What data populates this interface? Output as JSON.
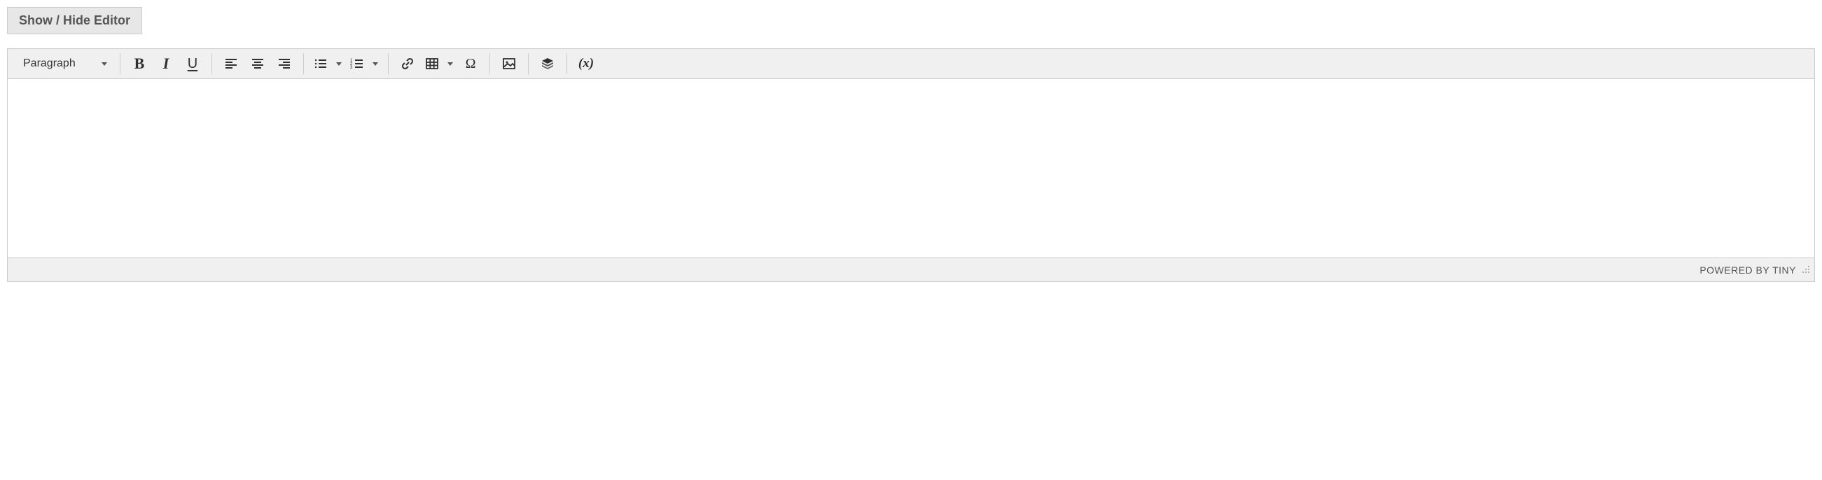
{
  "toggle_button_label": "Show / Hide Editor",
  "toolbar": {
    "format_label": "Paragraph"
  },
  "statusbar": {
    "branding": "POWERED BY TINY"
  },
  "content": ""
}
